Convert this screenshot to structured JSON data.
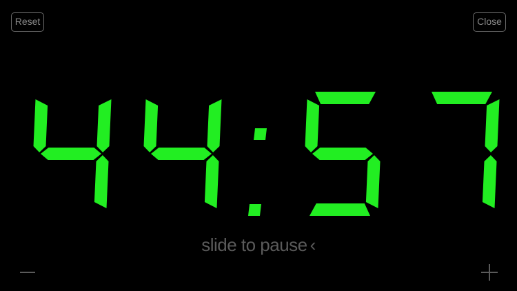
{
  "controls": {
    "reset_label": "Reset",
    "close_label": "Close"
  },
  "timer": {
    "minutes": "44",
    "seconds": "57",
    "display": "44:57",
    "digit_color": "#22ee22"
  },
  "slider": {
    "label": "slide to pause",
    "chevron": "‹"
  },
  "adjust": {
    "decrease_icon": "minus-icon",
    "increase_icon": "plus-icon"
  }
}
